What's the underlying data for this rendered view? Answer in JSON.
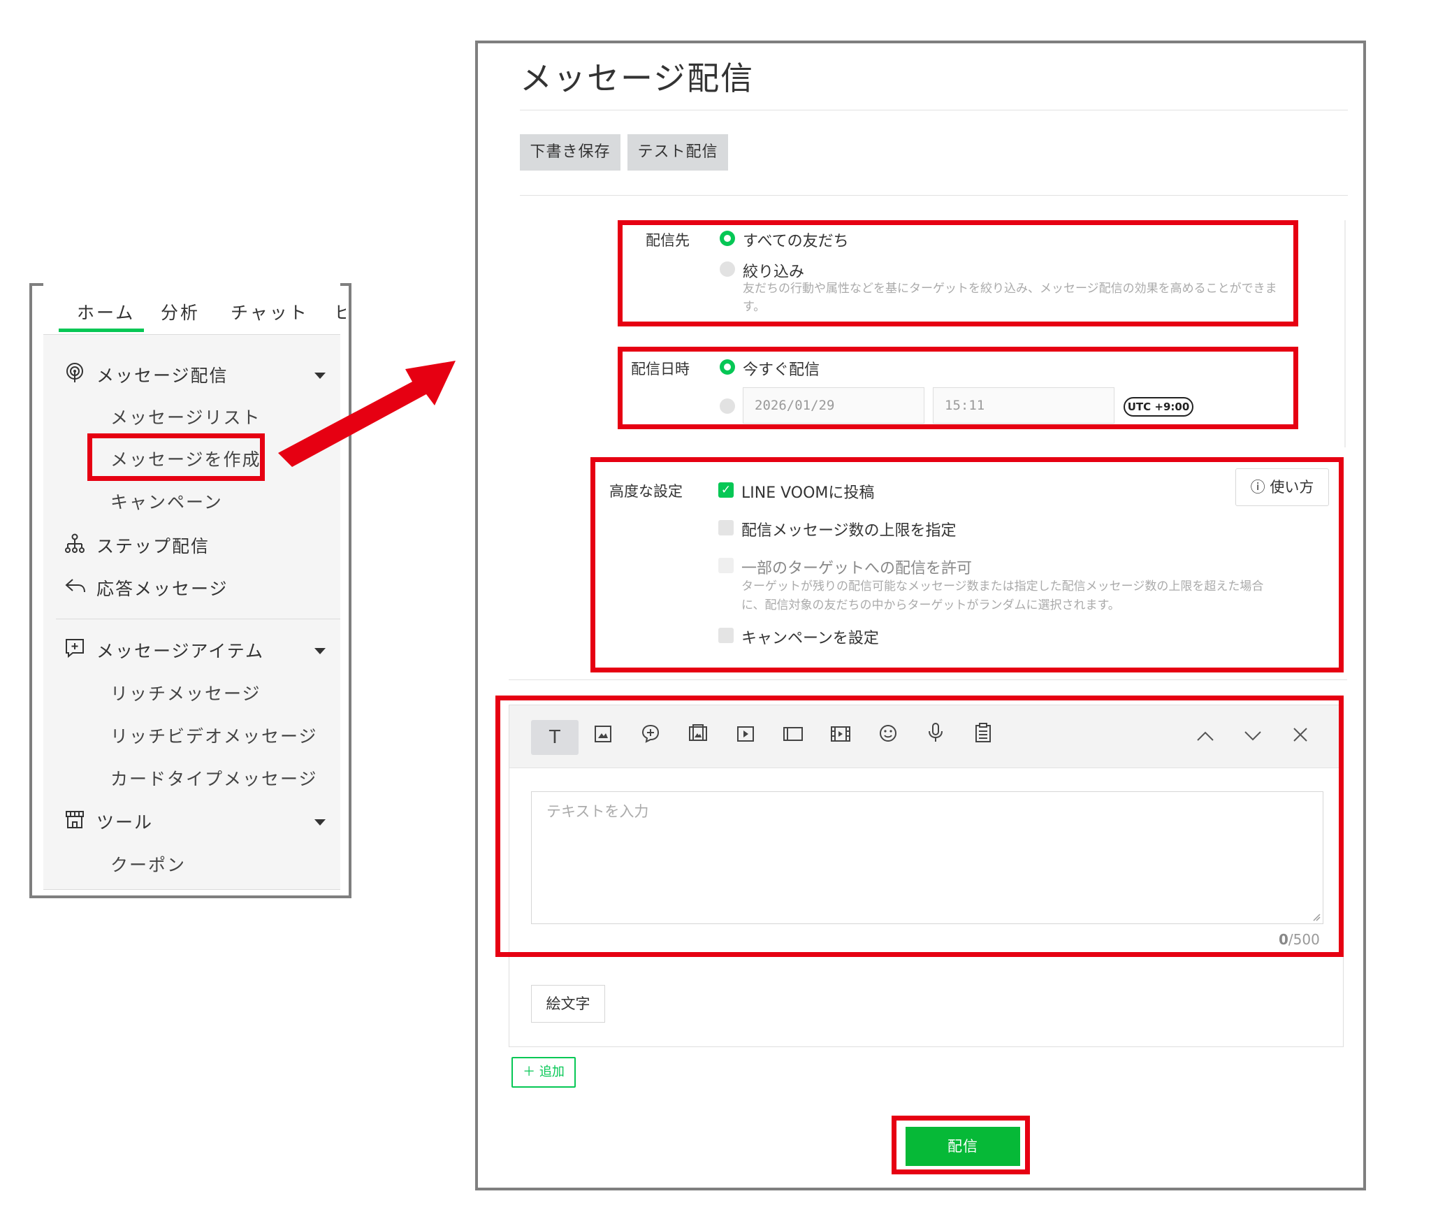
{
  "sidebar": {
    "tabs": [
      "ホーム",
      "分析",
      "チャット",
      "ヒ"
    ],
    "sections": [
      {
        "label": "メッセージ配信",
        "icon": "broadcast-icon",
        "expandable": true,
        "items": [
          "メッセージリスト",
          "メッセージを作成",
          "キャンペーン"
        ]
      },
      {
        "label": "ステップ配信",
        "icon": "flow-icon"
      },
      {
        "label": "応答メッセージ",
        "icon": "reply-icon"
      },
      {
        "label": "メッセージアイテム",
        "icon": "add-message-icon",
        "expandable": true,
        "items": [
          "リッチメッセージ",
          "リッチビデオメッセージ",
          "カードタイプメッセージ"
        ]
      },
      {
        "label": "ツール",
        "icon": "shop-icon",
        "expandable": true,
        "items": [
          "クーポン"
        ]
      }
    ],
    "highlighted_item": "メッセージを作成"
  },
  "main": {
    "title": "メッセージ配信",
    "buttons": {
      "save_draft": "下書き保存",
      "test_send": "テスト配信"
    },
    "recipients": {
      "label": "配信先",
      "options": [
        "すべての友だち",
        "絞り込み"
      ],
      "selected": "すべての友だち",
      "hint": "友だちの行動や属性などを基にターゲットを絞り込み、メッセージ配信の効果を高めることができま",
      "hint_cont": "す。"
    },
    "schedule": {
      "label": "配信日時",
      "now_label": "今すぐ配信",
      "date": "2026/01/29",
      "time": "15:11",
      "timezone": "UTC +9:00"
    },
    "advanced": {
      "label": "高度な設定",
      "help": "使い方",
      "options": {
        "voom": "LINE VOOMに投稿",
        "limit": "配信メッセージ数の上限を指定",
        "partial": "一部のターゲットへの配信を許可",
        "campaign": "キャンペーンを設定"
      },
      "partial_hint_1": "ターゲットが残りの配信可能なメッセージ数または指定した配信メッセージ数の上限を超えた場合",
      "partial_hint_2": "に、配信対象の友だちの中からターゲットがランダムに選択されます。",
      "voom_checked": true
    },
    "editor": {
      "toolbar_icons": [
        "text-icon",
        "image-icon",
        "add-bubble-icon",
        "rich-image-icon",
        "video-icon",
        "card-icon",
        "rich-video-icon",
        "emoji-icon",
        "audio-icon",
        "clipboard-icon"
      ],
      "placeholder": "テキストを入力",
      "count": "0",
      "max": "/500",
      "emoji_button": "絵文字"
    },
    "add_button": "＋ 追加",
    "send_button": "配信"
  },
  "colors": {
    "accent": "#06c755",
    "highlight": "#e60012"
  }
}
